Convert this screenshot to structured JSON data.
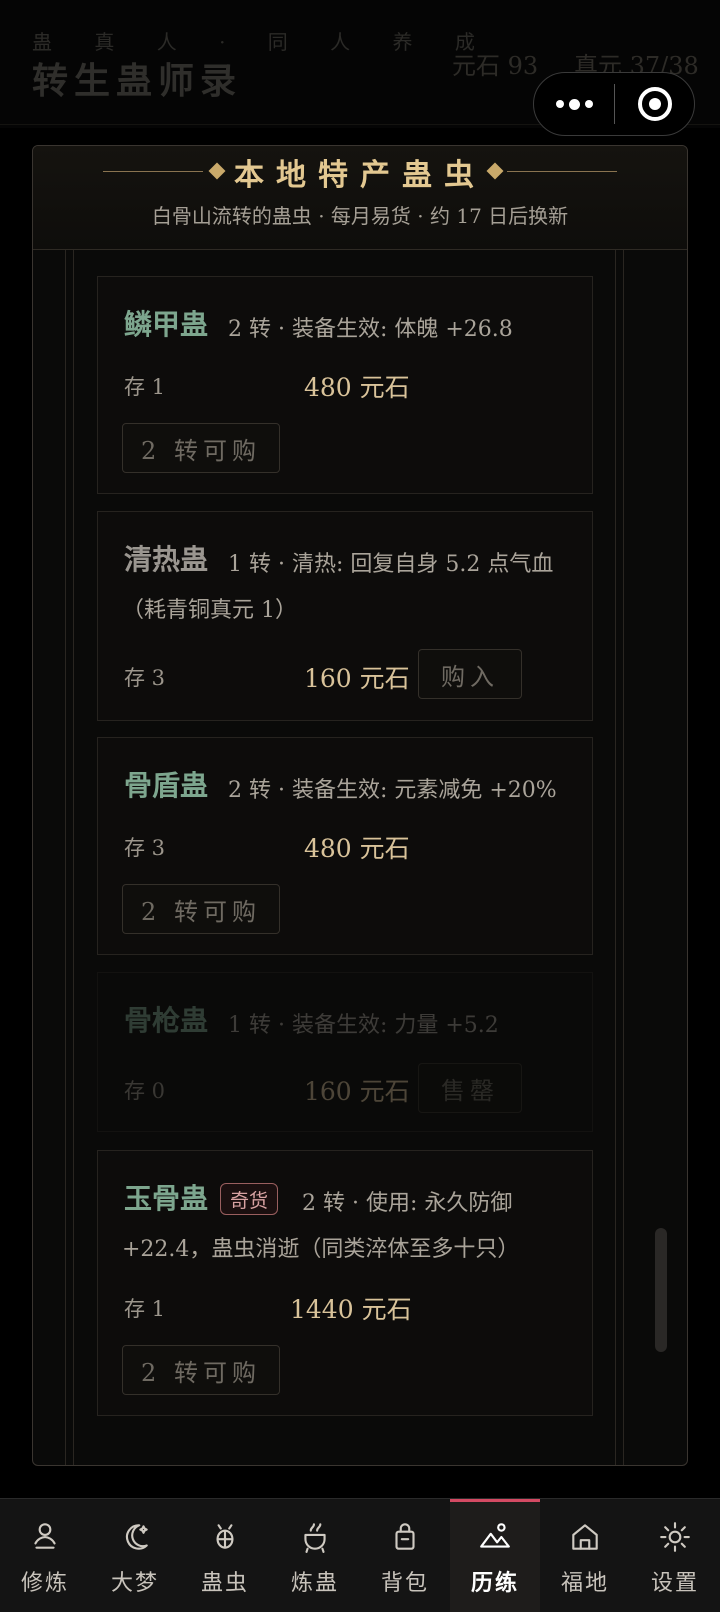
{
  "background": {
    "subtitle": "蛊 真 人 · 同 人 养 成",
    "title": "转生蛊师录",
    "stat_stone": "元石 93",
    "stat_essence": "真元 37/38"
  },
  "modal": {
    "title": "本地特产蛊虫",
    "subtitle": "白骨山流转的蛊虫 · 每月易货 · 约 17 日后换新",
    "items": [
      {
        "name": "鳞甲蛊",
        "desc": "2 转 · 装备生效: 体魄 +26.8",
        "desc2": "",
        "stock": "存 1",
        "price": "480 元石",
        "button": "2 转可购"
      },
      {
        "name": "清热蛊",
        "desc": "1 转 · 清热: 回复自身 5.2 点气血",
        "desc2": "（耗青铜真元 1）",
        "stock": "存 3",
        "price": "160 元石",
        "button": "购入"
      },
      {
        "name": "骨盾蛊",
        "desc": "2 转 · 装备生效: 元素减免 +20%",
        "desc2": "",
        "stock": "存 3",
        "price": "480 元石",
        "button": "2 转可购"
      },
      {
        "name": "骨枪蛊",
        "desc": "1 转 · 装备生效: 力量 +5.2",
        "desc2": "",
        "stock": "存 0",
        "price": "160 元石",
        "button": "售罄"
      },
      {
        "name": "玉骨蛊",
        "badge": "奇货",
        "desc": "2 转 · 使用: 永久防御",
        "desc2": "+22.4，蛊虫消逝（同类淬体至多十只）",
        "stock": "存 1",
        "price": "1440 元石",
        "button": "2 转可购"
      }
    ]
  },
  "tabs": [
    {
      "label": "修炼",
      "icon": "person-icon"
    },
    {
      "label": "大梦",
      "icon": "moon-icon"
    },
    {
      "label": "蛊虫",
      "icon": "bug-icon"
    },
    {
      "label": "炼蛊",
      "icon": "cauldron-icon"
    },
    {
      "label": "背包",
      "icon": "bag-icon"
    },
    {
      "label": "历练",
      "icon": "mountain-icon",
      "active": true
    },
    {
      "label": "福地",
      "icon": "house-icon"
    },
    {
      "label": "设置",
      "icon": "gear-icon"
    }
  ],
  "colors": {
    "accent": "#d44a63",
    "gold": "#e3c891",
    "jade": "#7da68e"
  }
}
